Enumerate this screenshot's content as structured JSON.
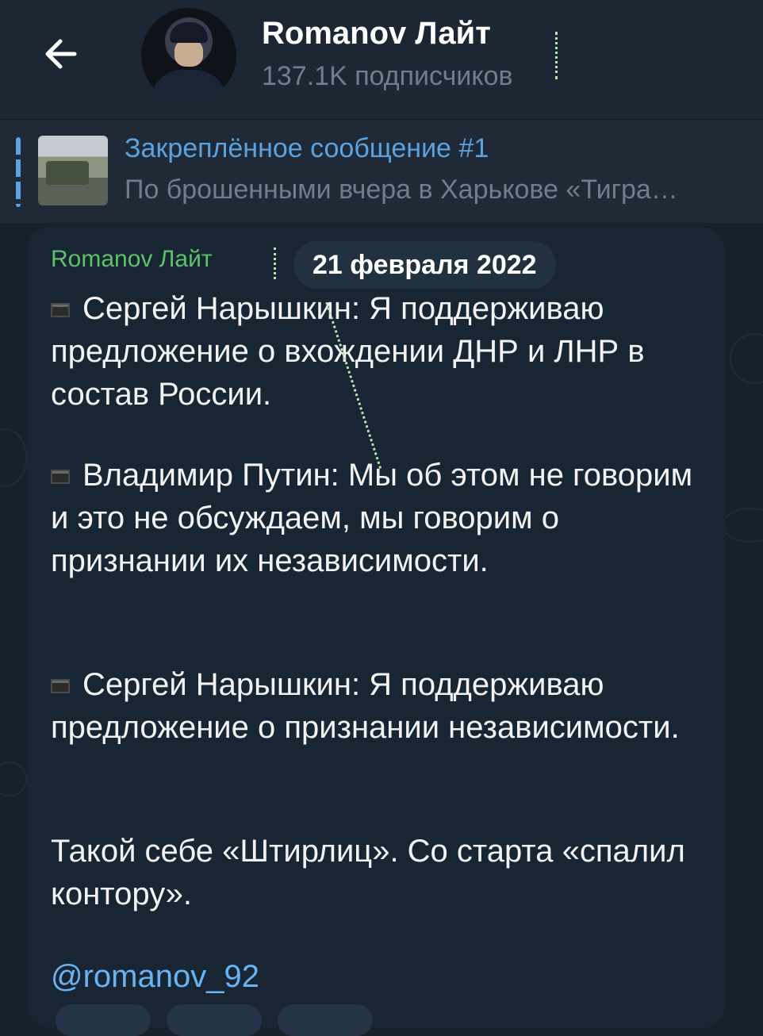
{
  "header": {
    "channel_title": "Romanov Лайт",
    "subscribers": "137.1K подписчиков"
  },
  "pinned": {
    "title": "Закреплённое сообщение #1",
    "text": "По брошенными вчера в Харькове «Тигра…"
  },
  "message": {
    "sender": "Romanov Лайт",
    "date": "21 февраля 2022",
    "paragraphs": [
      "Сергей Нарышкин: Я поддерживаю предложение о вхождении ДНР и ЛНР в состав России.",
      "Владимир Путин: Мы об этом не говорим и это не обсуждаем, мы говорим о признании их независимости.",
      "Сергей Нарышкин: Я поддерживаю предложение о признании независимости.",
      "Такой себе «Штирлиц». Со старта «спалил контору».",
      "@romanov_92"
    ]
  },
  "colors": {
    "background": "#17212b",
    "header": "#1d2733",
    "bubble": "#182533",
    "accent_blue": "#5aa2e0",
    "sender_green": "#5ec26b",
    "link": "#6ab3f3"
  },
  "icons": [
    "back-arrow-icon",
    "pin-thumbnail",
    "black-square-icon"
  ]
}
